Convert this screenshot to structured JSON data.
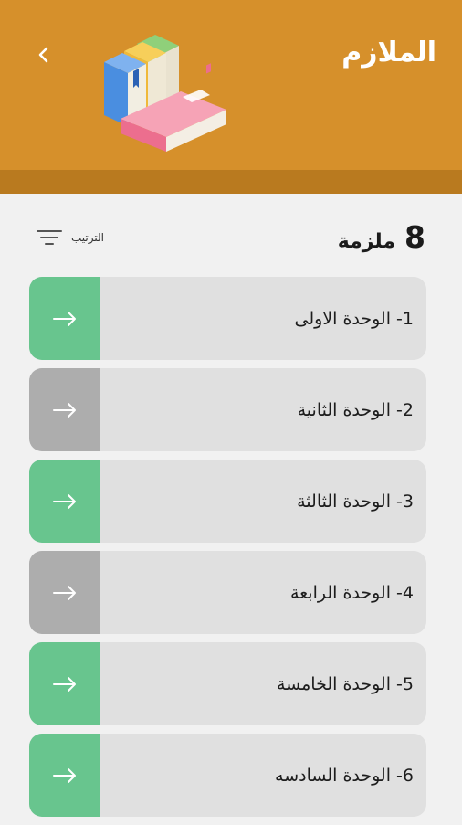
{
  "header": {
    "title": "الملازم",
    "back_icon": "chevron-left-icon",
    "illustration": "books-illustration"
  },
  "summary": {
    "count": "8",
    "count_label": "ملزمة",
    "sort_label": "الترتيب",
    "sort_icon": "sort-lines-icon"
  },
  "units": [
    {
      "label": "1- الوحدة الاولى",
      "status": "green"
    },
    {
      "label": "2-  الوحدة الثانية",
      "status": "gray"
    },
    {
      "label": "3- الوحدة الثالثة",
      "status": "green"
    },
    {
      "label": "4- الوحدة الرابعة",
      "status": "gray"
    },
    {
      "label": "5- الوحدة الخامسة",
      "status": "green"
    },
    {
      "label": "6- الوحدة السادسه",
      "status": "green"
    }
  ],
  "colors": {
    "header": "#d6902b",
    "header_strip": "#b97a1f",
    "green": "#68c58e",
    "gray": "#adadad"
  }
}
